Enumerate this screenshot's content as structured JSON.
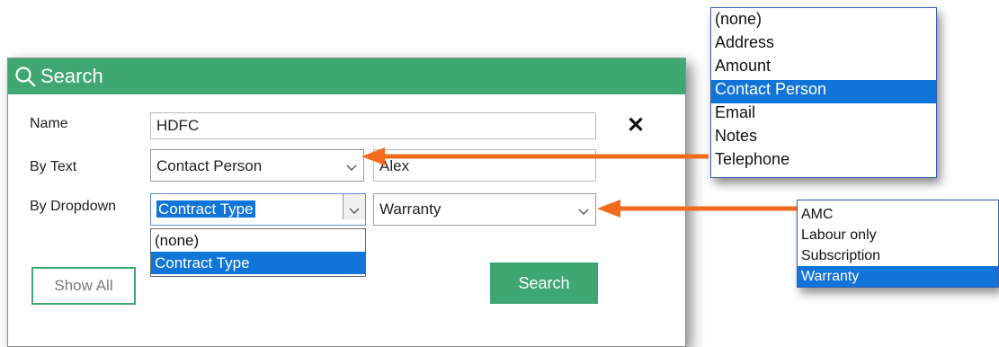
{
  "panel": {
    "title": "Search",
    "close_label": "✕",
    "name_label": "Name",
    "name_value": "HDFC",
    "bytext_label": "By Text",
    "bytext_select": "Contact Person",
    "bytext_value": "Alex",
    "bydropdown_label": "By Dropdown",
    "bydropdown_select": "Contract Type",
    "bydropdown_value": "Warranty",
    "inline_options": [
      "(none)",
      "Contract Type"
    ],
    "show_all_label": "Show All",
    "search_label": "Search"
  },
  "text_field_options": [
    "(none)",
    "Address",
    "Amount",
    "Contact Person",
    "Email",
    "Notes",
    "Telephone"
  ],
  "text_field_selected": "Contact Person",
  "dropdown_value_options": [
    "AMC",
    "Labour only",
    "Subscription",
    "Warranty"
  ],
  "dropdown_value_selected": "Warranty",
  "colors": {
    "header_green": "#3fa872",
    "selection_blue": "#1174d8",
    "arrow_orange": "#f26b1d"
  }
}
